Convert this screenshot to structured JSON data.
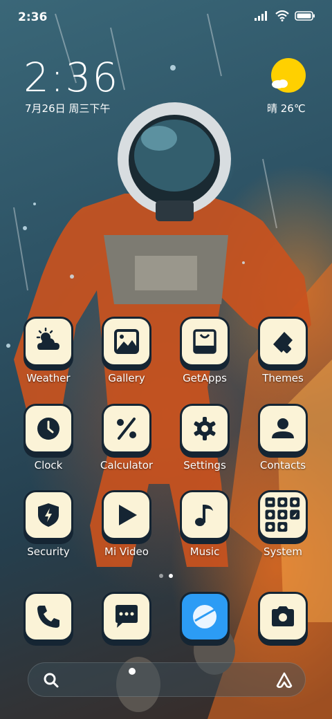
{
  "status_bar": {
    "time": "2:36",
    "icons": [
      "signal-icon",
      "wifi-icon",
      "battery-icon"
    ]
  },
  "clock_widget": {
    "time": "2:36",
    "date": "7月26日 周三下午"
  },
  "weather_widget": {
    "text": "晴 26℃",
    "icon": "sun-cloud-icon"
  },
  "apps": [
    {
      "label": "Weather",
      "icon": "weather-icon"
    },
    {
      "label": "Gallery",
      "icon": "gallery-icon"
    },
    {
      "label": "GetApps",
      "icon": "getapps-icon"
    },
    {
      "label": "Themes",
      "icon": "themes-icon"
    },
    {
      "label": "Clock",
      "icon": "clock-icon"
    },
    {
      "label": "Calculator",
      "icon": "calculator-icon"
    },
    {
      "label": "Settings",
      "icon": "settings-icon"
    },
    {
      "label": "Contacts",
      "icon": "contacts-icon"
    },
    {
      "label": "Security",
      "icon": "security-icon"
    },
    {
      "label": "Mi Video",
      "icon": "video-icon"
    },
    {
      "label": "Music",
      "icon": "music-icon"
    },
    {
      "label": "System",
      "icon": "system-folder-icon"
    }
  ],
  "dock": [
    {
      "icon": "phone-icon"
    },
    {
      "icon": "messages-icon"
    },
    {
      "icon": "browser-icon"
    },
    {
      "icon": "camera-icon"
    }
  ],
  "page_indicator": {
    "count": 2,
    "active": 2
  },
  "search_bar": {
    "icons": [
      "search-icon",
      "assistant-icon"
    ]
  },
  "colors": {
    "tile_bg": "#fbf3d7",
    "tile_border": "#152533",
    "browser_blue": "#2c9cf5",
    "sun": "#ffd000"
  }
}
